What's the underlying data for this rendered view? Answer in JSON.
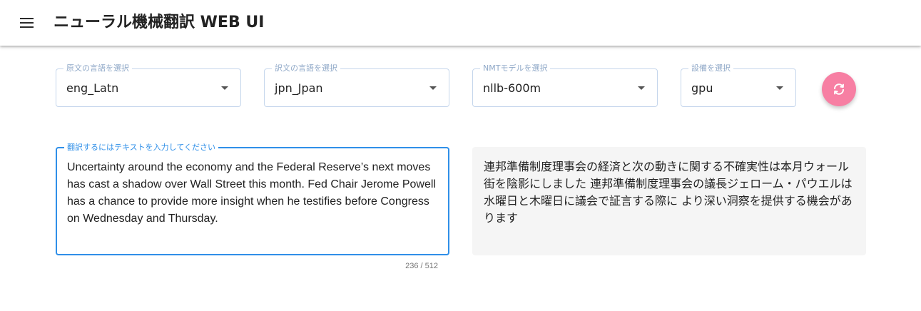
{
  "app": {
    "title": "ニューラル機械翻訳 WEB UI",
    "menu_icon": "menu-icon"
  },
  "selectors": {
    "source_language": {
      "label": "原文の言語を選択",
      "value": "eng_Latn"
    },
    "target_language": {
      "label": "訳文の言語を選択",
      "value": "jpn_Jpan"
    },
    "nmt_model": {
      "label": "NMTモデルを選択",
      "value": "nllb-600m"
    },
    "device": {
      "label": "設備を選択",
      "value": "gpu"
    }
  },
  "swap_button": {
    "icon": "swap-icon",
    "color": "#f77fa3"
  },
  "input": {
    "label": "翻訳するにはテキストを入力してください",
    "text": "Uncertainty around the economy and the Federal Reserve’s next moves has cast a shadow over Wall Street this month. Fed Chair Jerome Powell has a chance to provide more insight when he testifies before Congress on Wednesday and Thursday.",
    "counter": "236 / 512"
  },
  "output": {
    "text": "連邦準備制度理事会の経済と次の動きに関する不確実性は本月ウォール街を陰影にしました 連邦準備制度理事会の議長ジェローム・パウエルは水曜日と木曜日に議会で証言する際に より深い洞察を提供する機会があります"
  },
  "colors": {
    "accent": "#2f8fe8",
    "outline": "#c5d6ec",
    "output_bg": "#f5f5f5"
  }
}
